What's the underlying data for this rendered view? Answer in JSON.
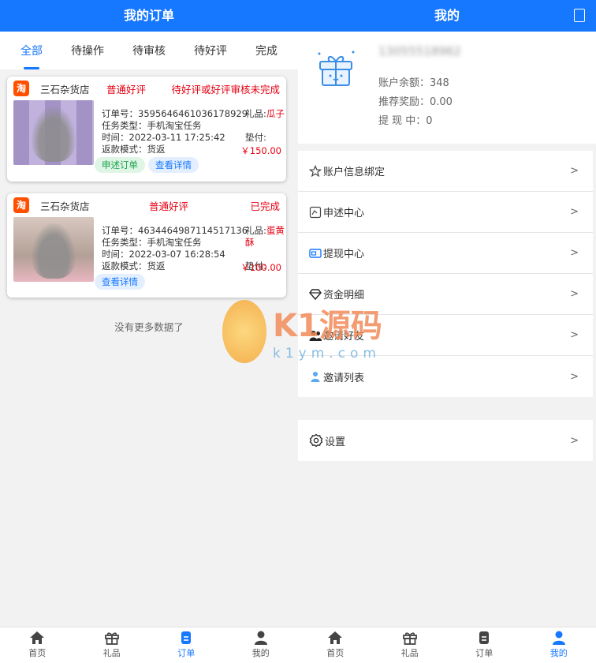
{
  "orders_page": {
    "title": "我的订单",
    "tabs": [
      "全部",
      "待操作",
      "待审核",
      "待好评",
      "完成"
    ],
    "orders": [
      {
        "platform": "淘",
        "shop": "三石杂货店",
        "type": "普通好评",
        "status": "待好评或好评审核未完成",
        "order_no": "订单号：3595646461036178929",
        "task_type": "任务类型：手机淘宝任务",
        "time": "时间：2022-03-11 17:25:42",
        "refund_mode": "返款模式：货返",
        "gift_label": "礼品:",
        "gift_name": "瓜子",
        "advance_label": "垫付:",
        "price": "￥150.00",
        "buttons": [
          "申述订单",
          "查看详情"
        ]
      },
      {
        "platform": "淘",
        "shop": "三石杂货店",
        "type": "普通好评",
        "status": "已完成",
        "order_no": "订单号：4634464987114517136",
        "task_type": "任务类型：手机淘宝任务",
        "time": "时间：2022-03-07 16:28:54",
        "refund_mode": "返款模式：货返",
        "gift_label": "礼品:",
        "gift_name": "蛋黄酥",
        "advance_label": "垫付:",
        "price": "￥100.00",
        "buttons": [
          "查看详情"
        ]
      }
    ],
    "no_more": "没有更多数据了"
  },
  "profile_page": {
    "title": "我的",
    "phone": "13055518962",
    "balance": "账户余额：348",
    "referral": "推荐奖励：0.00",
    "withdrawing": "提 现 中：0",
    "menu1": [
      {
        "label": "账户信息绑定",
        "icon": "star-icon"
      },
      {
        "label": "申述中心",
        "icon": "appeal-icon"
      },
      {
        "label": "提现中心",
        "icon": "wallet-icon"
      },
      {
        "label": "资金明细",
        "icon": "diamond-icon"
      },
      {
        "label": "邀请好友",
        "icon": "friends-icon"
      },
      {
        "label": "邀请列表",
        "icon": "user-icon"
      }
    ],
    "menu2": [
      {
        "label": "设置",
        "icon": "settings-icon"
      }
    ],
    "arrow": ">"
  },
  "nav": [
    "首页",
    "礼品",
    "订单",
    "我的"
  ],
  "watermark": {
    "text": "K1源码",
    "sub": "k1ym.com"
  },
  "colors": {
    "primary": "#1677ff",
    "red": "#e60012",
    "taobao": "#ff5000",
    "green": "#19a34a"
  }
}
